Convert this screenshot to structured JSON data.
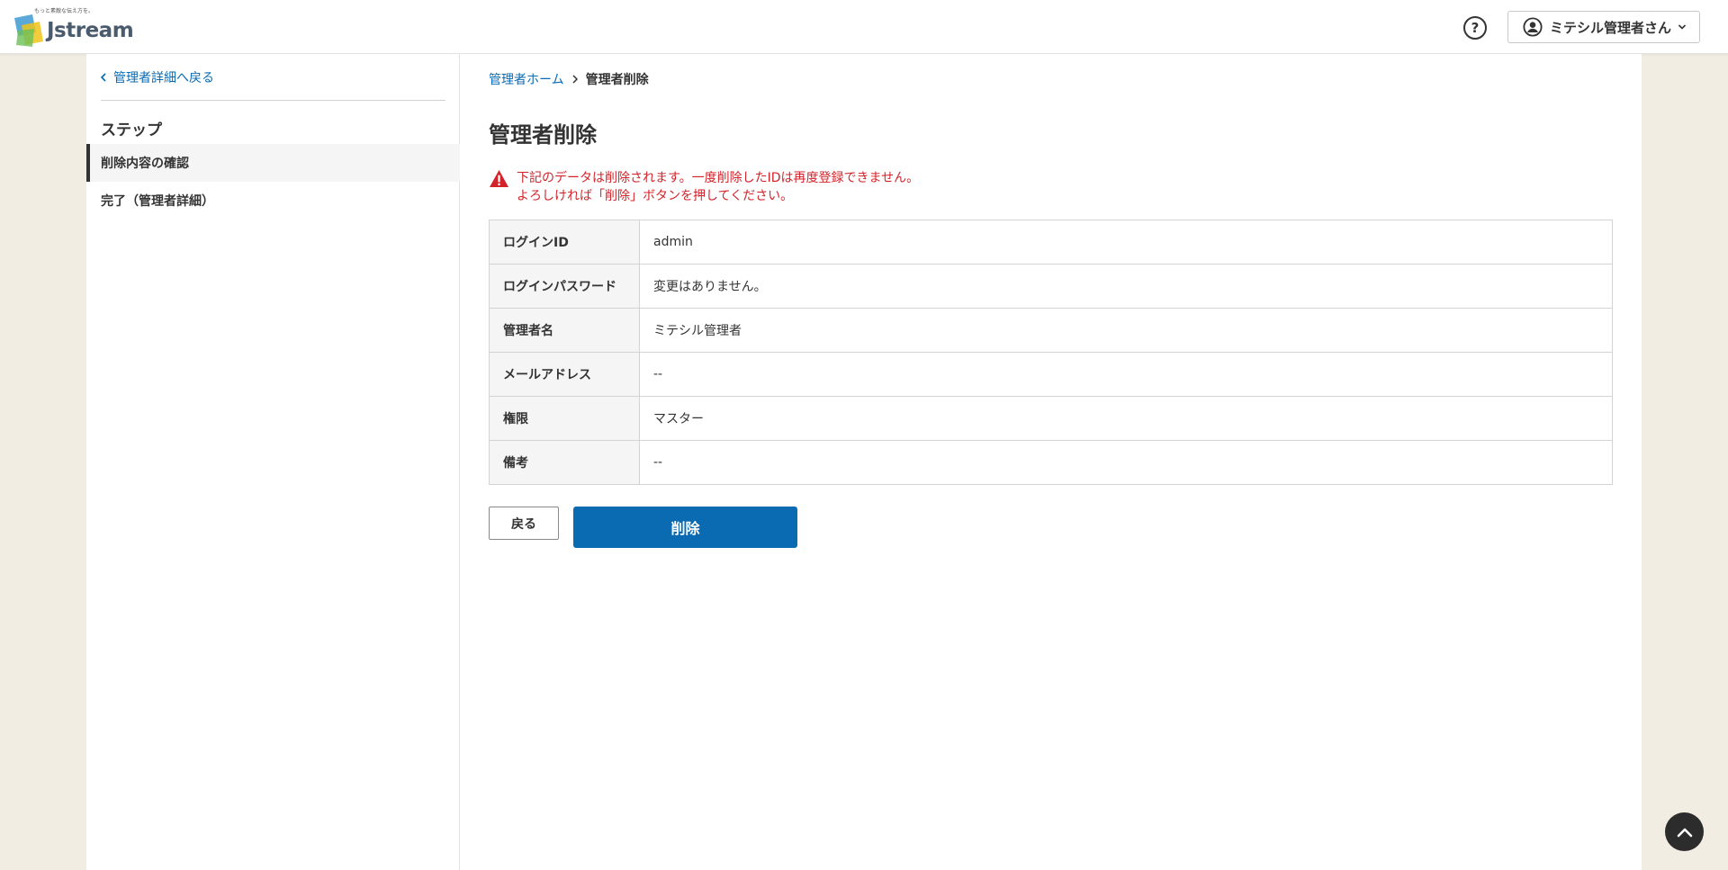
{
  "header": {
    "logo": {
      "tagline": "もっと素敵な伝え方を。",
      "wordmark": "Jstream"
    },
    "help_icon": "question-circle-icon",
    "help_glyph": "?",
    "user_menu": {
      "icon": "user-circle-icon",
      "name": "ミテシル管理者さん",
      "chevron_icon": "chevron-down-icon"
    }
  },
  "sidebar": {
    "back_link": "管理者詳細へ戻る",
    "steps_heading": "ステップ",
    "steps": [
      {
        "label": "削除内容の確認",
        "active": true
      },
      {
        "label": "完了（管理者詳細）",
        "active": false
      }
    ]
  },
  "main": {
    "breadcrumb": {
      "home": "管理者ホーム",
      "current": "管理者削除"
    },
    "title": "管理者削除",
    "warning": {
      "line1": "下記のデータは削除されます。一度削除したIDは再度登録できません。",
      "line2": "よろしければ「削除」ボタンを押してください。"
    },
    "table": [
      {
        "label": "ログインID",
        "value": "admin"
      },
      {
        "label": "ログインパスワード",
        "value": "変更はありません。"
      },
      {
        "label": "管理者名",
        "value": "ミテシル管理者"
      },
      {
        "label": "メールアドレス",
        "value": "--"
      },
      {
        "label": "権限",
        "value": "マスター"
      },
      {
        "label": "備考",
        "value": "--"
      }
    ],
    "buttons": {
      "back": "戻る",
      "delete": "削除"
    }
  },
  "colors": {
    "accent": "#0a6bb3",
    "warning": "#d3232a",
    "page_background": "#f2ede3"
  }
}
